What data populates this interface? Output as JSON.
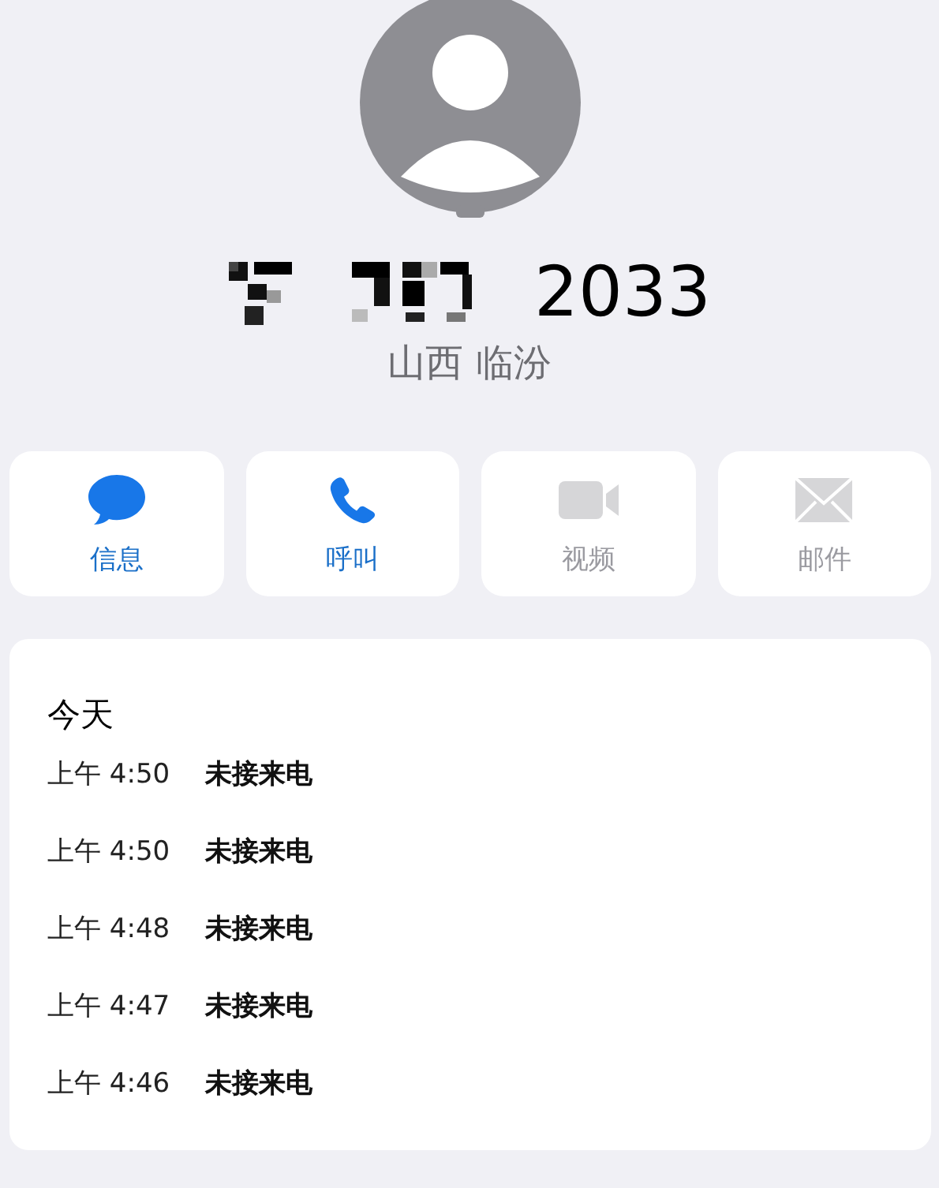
{
  "contact": {
    "number_visible": "2033",
    "location": "山西 临汾"
  },
  "actions": [
    {
      "kind": "message",
      "label": "信息",
      "disabled": false
    },
    {
      "kind": "call",
      "label": "呼叫",
      "disabled": false
    },
    {
      "kind": "video",
      "label": "视频",
      "disabled": true
    },
    {
      "kind": "mail",
      "label": "邮件",
      "disabled": true
    }
  ],
  "history": {
    "heading": "今天",
    "rows": [
      {
        "time": "上午 4:50",
        "type": "未接来电"
      },
      {
        "time": "上午 4:50",
        "type": "未接来电"
      },
      {
        "time": "上午 4:48",
        "type": "未接来电"
      },
      {
        "time": "上午 4:47",
        "type": "未接来电"
      },
      {
        "time": "上午 4:46",
        "type": "未接来电"
      }
    ]
  }
}
